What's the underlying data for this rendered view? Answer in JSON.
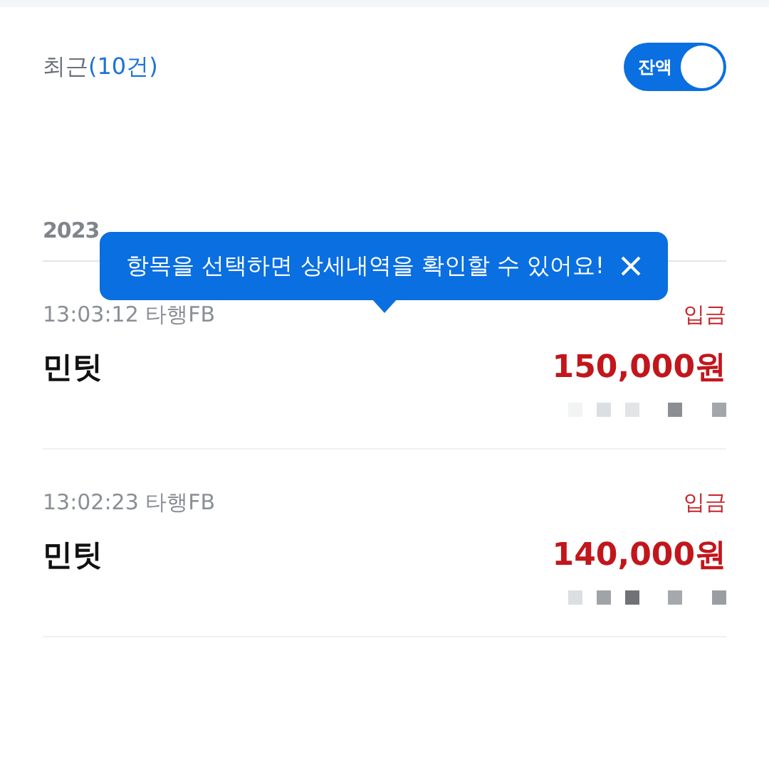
{
  "header": {
    "label": "최근",
    "count": "(10건)",
    "toggle": {
      "label": "잔액",
      "on": true
    }
  },
  "date": "2023",
  "tooltip": {
    "text": "항목을 선택하면 상세내역을 확인할 수 있어요!"
  },
  "transactions": [
    {
      "time": "13:03:12 타행FB",
      "type": "입금",
      "name": "민팃",
      "amount": "150,000원"
    },
    {
      "time": "13:02:23 타행FB",
      "type": "입금",
      "name": "민팃",
      "amount": "140,000원"
    }
  ]
}
